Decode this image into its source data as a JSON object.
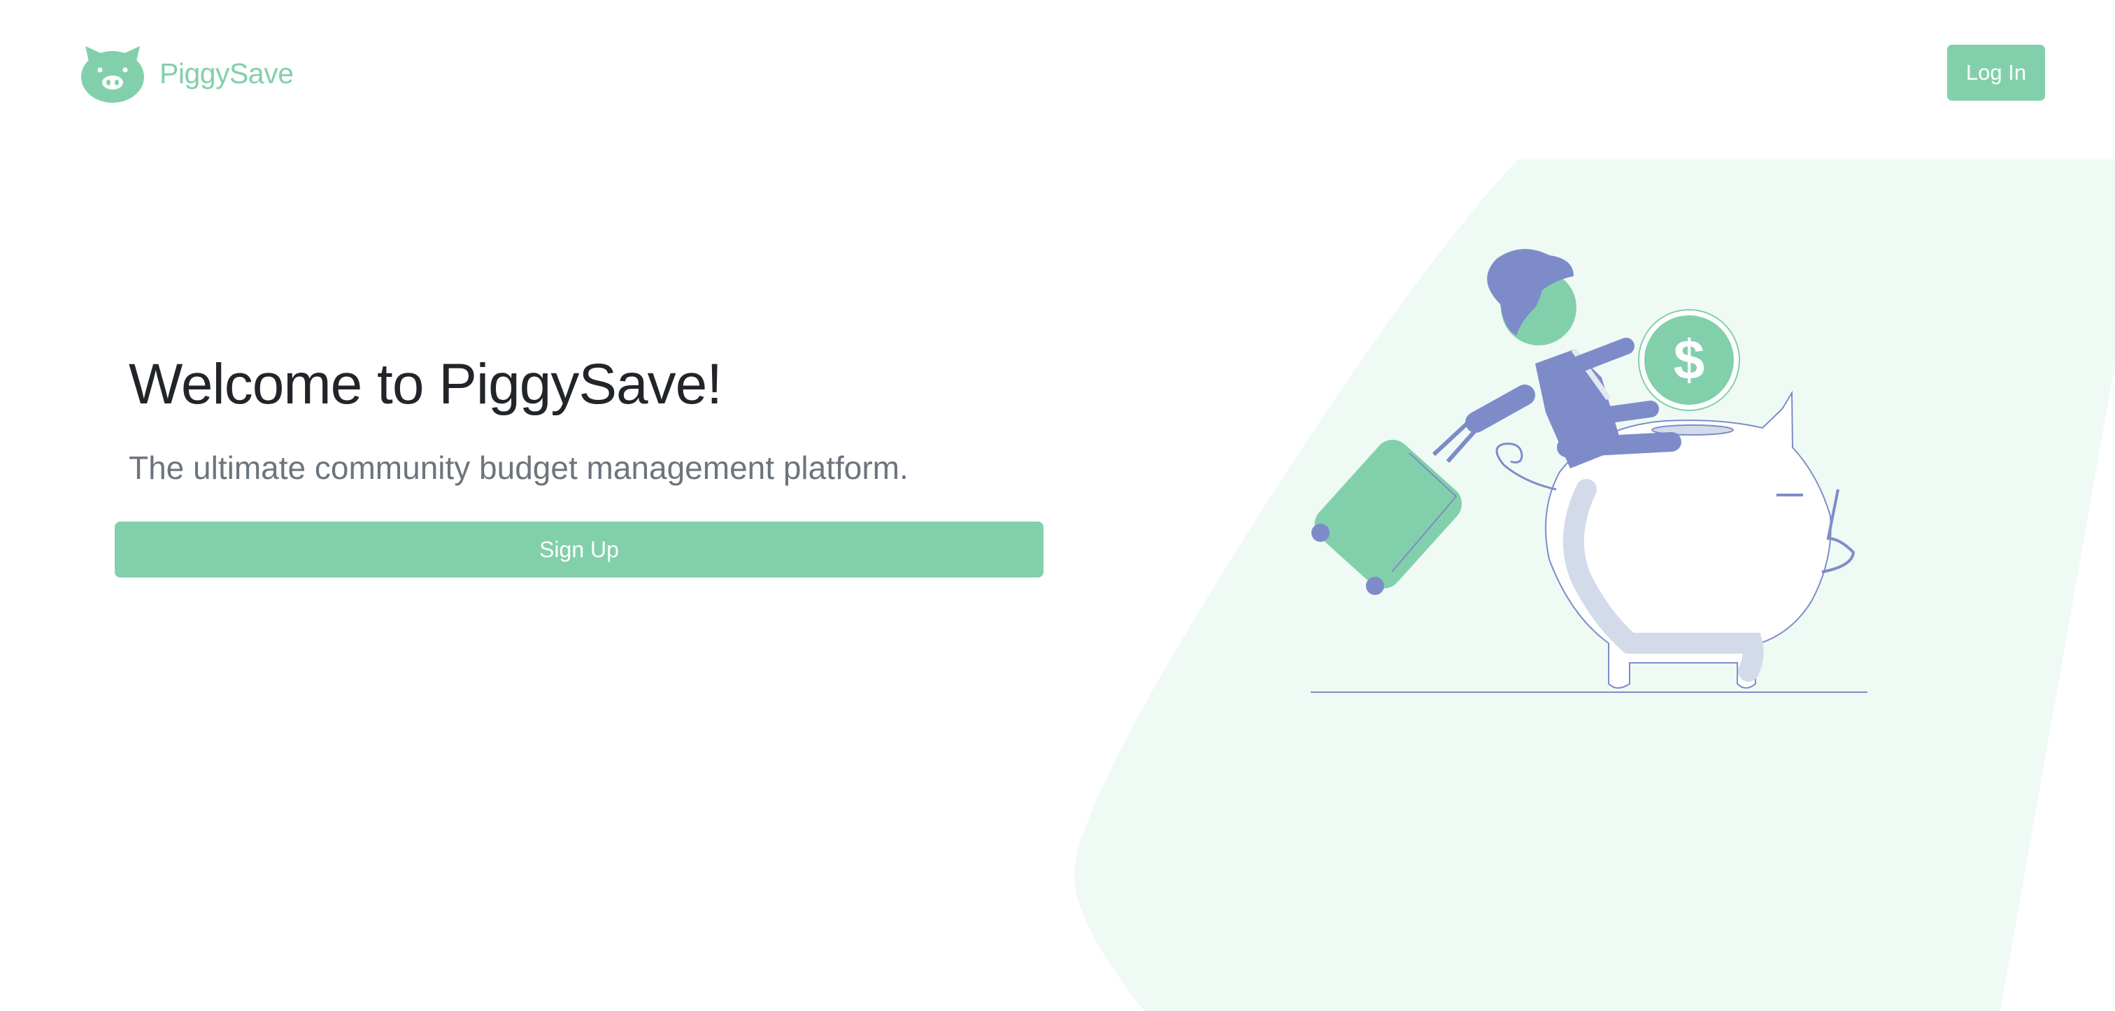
{
  "header": {
    "brand_name": "PiggySave",
    "login_label": "Log In"
  },
  "hero": {
    "title": "Welcome to PiggySave!",
    "subtitle": "The ultimate community budget management platform.",
    "signup_label": "Sign Up"
  },
  "illustration": {
    "coin_symbol": "$"
  },
  "colors": {
    "accent": "#82d0ab",
    "accent_light": "#eefaf4",
    "figure": "#7d8cc9",
    "title_text": "#212529",
    "subtitle_text": "#6c757d"
  },
  "icons": {
    "logo": "pig-icon",
    "illustration": "traveler-piggy-bank-illustration"
  }
}
